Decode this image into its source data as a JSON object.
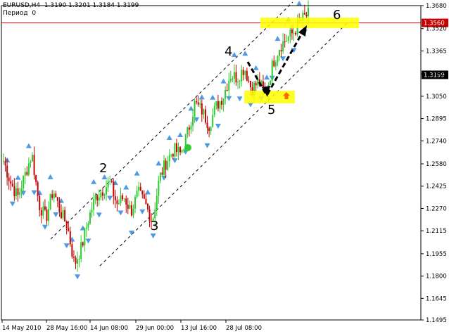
{
  "header": {
    "symbol_line": "EURUSD,H4  1.3190 1.3201 1.3184 1.3199",
    "indicator_line": "Период  0"
  },
  "chart_data": {
    "type": "candlestick",
    "symbol": "EURUSD",
    "timeframe": "H4",
    "ohlc_last": {
      "open": 1.319,
      "high": 1.3201,
      "low": 1.3184,
      "close": 1.3199
    },
    "ylim": [
      1.1495,
      1.368
    ],
    "y_ticks": [
      "1.3680",
      "1.3520",
      "1.3365",
      "1.3205",
      "1.3050",
      "1.2895",
      "1.2740",
      "1.2580",
      "1.2425",
      "1.2270",
      "1.2115",
      "1.1955",
      "1.1800",
      "1.1645",
      "1.1495"
    ],
    "x_ticks": [
      "14 May 2010",
      "28 May 16:00",
      "14 Jun 08:00",
      "29 Jun 00:00",
      "13 Jul 16:00",
      "28 Jul 08:00"
    ],
    "price_labels": {
      "level": {
        "text": "1.3560",
        "value": 1.356,
        "color": "#cc0000"
      },
      "current": {
        "text": "1.3199",
        "value": 1.3199,
        "color": "#000000"
      }
    },
    "horizontal_line": {
      "value": 1.356,
      "color": "#ff0000"
    },
    "wave_labels": [
      "2",
      "3",
      "4",
      "5",
      "6"
    ],
    "colors": {
      "bull": "#2bcc2b",
      "bear": "#cc0000",
      "fractal": "#3d8ee0",
      "channel": "#000000",
      "highlight": "#ffff00",
      "forecast_arrow": "#000000"
    },
    "price_path": [
      1.26,
      1.245,
      1.235,
      1.25,
      1.265,
      1.23,
      1.22,
      1.24,
      1.225,
      1.215,
      1.188,
      1.2,
      1.22,
      1.235,
      1.24,
      1.245,
      1.23,
      1.235,
      1.225,
      1.238,
      1.23,
      1.218,
      1.248,
      1.26,
      1.268,
      1.265,
      1.28,
      1.3,
      1.295,
      1.285,
      1.298,
      1.305,
      1.32,
      1.318,
      1.325,
      1.31,
      1.315,
      1.305,
      1.328,
      1.34,
      1.345,
      1.35,
      1.358,
      1.362
    ]
  }
}
